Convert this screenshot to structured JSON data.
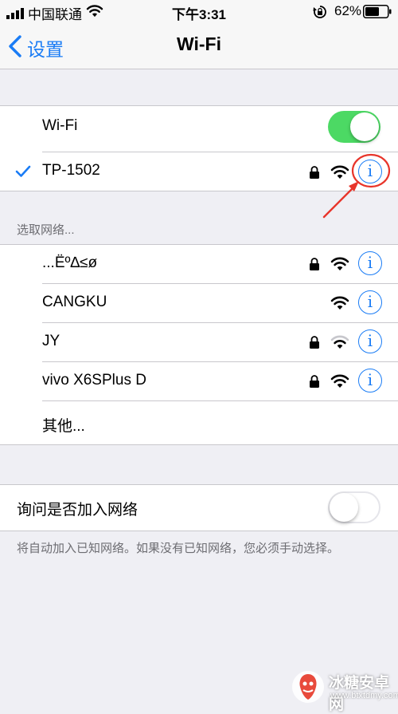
{
  "status_bar": {
    "carrier": "中国联通",
    "time": "下午3:31",
    "battery_pct": "62%"
  },
  "nav": {
    "back_label": "设置",
    "title": "Wi-Fi"
  },
  "wifi_section": {
    "toggle_label": "Wi-Fi",
    "toggle_on": true,
    "connected_network": "TP-1502"
  },
  "choose_network_header": "选取网络...",
  "networks": [
    {
      "name": "...Ëº∆≤ø",
      "locked": true
    },
    {
      "name": "CANGKU",
      "locked": false
    },
    {
      "name": "JY",
      "locked": true
    },
    {
      "name": "vivo X6SPlus D",
      "locked": true
    }
  ],
  "other_label": "其他...",
  "ask_to_join": {
    "label": "询问是否加入网络",
    "on": false,
    "note": "将自动加入已知网络。如果没有已知网络，您必须手动选择。"
  },
  "watermark": {
    "title": "冰糖安卓网",
    "url": "www.btxtdmy.com"
  },
  "colors": {
    "accent": "#1a7cf5",
    "toggle_on": "#4cd964",
    "annotation": "#e8352b",
    "background": "#efeff4"
  }
}
